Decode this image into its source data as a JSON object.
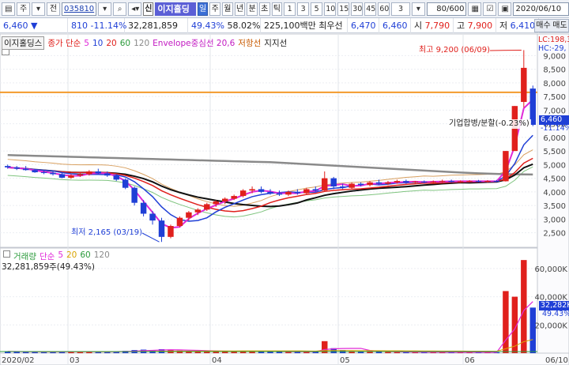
{
  "toolbar": {
    "menu_label": "주",
    "previous_label": "전",
    "code_value": "035810",
    "stock_name": "이지홀딩스",
    "credit_tag": "신",
    "periods": [
      "일",
      "주",
      "월",
      "년",
      "분",
      "초",
      "틱"
    ],
    "active_period": "일",
    "intervals": [
      "1",
      "3",
      "5",
      "10",
      "15",
      "30",
      "45",
      "60"
    ],
    "interval_select": "3",
    "count_value": "80",
    "count_total": "/600",
    "date_value": "2020/06/10"
  },
  "quote": {
    "price": "6,460",
    "change_arrow": "▼",
    "change": "810",
    "change_pct": "-11.14%",
    "volume": "32,281,859",
    "volume_ratio": "49.43%",
    "turnover_ratio": "58.02%",
    "amount": "225,100백만",
    "best_ask_label": "최우선",
    "best_ask": "6,470",
    "best_bid": "6,460",
    "open_label": "시",
    "open": "7,790",
    "high_label": "고",
    "high": "7,900",
    "low_label": "저",
    "low": "6,410",
    "sell_label": "매수",
    "buy_label": "매도"
  },
  "price_legend": {
    "name": "이지홀딩스",
    "ma_label": "종가 단순",
    "ma_periods": [
      "5",
      "10",
      "20",
      "60",
      "120"
    ],
    "envelope": "Envelope중심선 20,6",
    "resistance": "저항선",
    "support": "지지선"
  },
  "volume_legend": {
    "title": "거래량",
    "ma_label": "단순",
    "ma_periods": [
      "5",
      "20",
      "60",
      "120"
    ],
    "info": "32,281,859주(49.43%)"
  },
  "annotations": {
    "high_note": "최고 9,200 (06/09)",
    "low_note": "최저 2,165 (03/19)",
    "event_note": "기업합병/분할(-0.23%)",
    "upper_limit": "LC:198,3",
    "hc_label": "HC:-29,"
  },
  "price_axis": {
    "ticks": [
      "9,000",
      "8,500",
      "8,000",
      "7,500",
      "7,000",
      "6,500",
      "6,000",
      "5,500",
      "5,000",
      "4,500",
      "4,000",
      "3,500",
      "3,000",
      "2,500"
    ],
    "current_price_tag": "6,460",
    "current_change_tag": "-11.14%"
  },
  "volume_axis": {
    "ticks": [
      "60,000K",
      "40,000K",
      "20,000K"
    ],
    "current_volume_tag": "32,282K",
    "current_ratio_tag": "49.43%"
  },
  "date_axis": [
    "2020/02",
    "03",
    "04",
    "05",
    "06",
    "06/10"
  ],
  "colors": {
    "up": "#e0201c",
    "down": "#1f3fd6",
    "resistance_line": "#f39a2b",
    "ma5": "#e02ad8",
    "ma10": "#1f3fd6",
    "ma20": "#e0201c",
    "ma60": "#111111",
    "ma120": "#8a8a8a"
  },
  "chart_data": {
    "type": "candlestick",
    "price_ylim": [
      2200,
      9300
    ],
    "resistance_level": 7650,
    "candles": [
      {
        "o": 4950,
        "h": 5000,
        "l": 4850,
        "c": 4900
      },
      {
        "o": 4900,
        "h": 4950,
        "l": 4800,
        "c": 4850
      },
      {
        "o": 4850,
        "h": 4950,
        "l": 4780,
        "c": 4800
      },
      {
        "o": 4800,
        "h": 4850,
        "l": 4700,
        "c": 4720
      },
      {
        "o": 4720,
        "h": 4800,
        "l": 4650,
        "c": 4700
      },
      {
        "o": 4700,
        "h": 4780,
        "l": 4600,
        "c": 4650
      },
      {
        "o": 4650,
        "h": 4700,
        "l": 4500,
        "c": 4520
      },
      {
        "o": 4520,
        "h": 4650,
        "l": 4480,
        "c": 4600
      },
      {
        "o": 4600,
        "h": 4700,
        "l": 4550,
        "c": 4650
      },
      {
        "o": 4650,
        "h": 4800,
        "l": 4600,
        "c": 4750
      },
      {
        "o": 4750,
        "h": 4850,
        "l": 4650,
        "c": 4680
      },
      {
        "o": 4680,
        "h": 4750,
        "l": 4550,
        "c": 4600
      },
      {
        "o": 4600,
        "h": 4650,
        "l": 4400,
        "c": 4450
      },
      {
        "o": 4450,
        "h": 4500,
        "l": 4100,
        "c": 4150
      },
      {
        "o": 4150,
        "h": 4200,
        "l": 3500,
        "c": 3600
      },
      {
        "o": 3600,
        "h": 3700,
        "l": 3100,
        "c": 3200
      },
      {
        "o": 3200,
        "h": 3300,
        "l": 2800,
        "c": 2950
      },
      {
        "o": 2950,
        "h": 3050,
        "l": 2165,
        "c": 2350
      },
      {
        "o": 2350,
        "h": 2800,
        "l": 2300,
        "c": 2750
      },
      {
        "o": 2750,
        "h": 3100,
        "l": 2700,
        "c": 3050
      },
      {
        "o": 3050,
        "h": 3300,
        "l": 2950,
        "c": 3250
      },
      {
        "o": 3250,
        "h": 3400,
        "l": 3150,
        "c": 3350
      },
      {
        "o": 3350,
        "h": 3600,
        "l": 3300,
        "c": 3550
      },
      {
        "o": 3550,
        "h": 3700,
        "l": 3450,
        "c": 3650
      },
      {
        "o": 3650,
        "h": 3800,
        "l": 3550,
        "c": 3750
      },
      {
        "o": 3750,
        "h": 3900,
        "l": 3700,
        "c": 3850
      },
      {
        "o": 3850,
        "h": 4100,
        "l": 3800,
        "c": 4050
      },
      {
        "o": 4050,
        "h": 4200,
        "l": 3950,
        "c": 4100
      },
      {
        "o": 4100,
        "h": 4200,
        "l": 3950,
        "c": 4000
      },
      {
        "o": 4000,
        "h": 4100,
        "l": 3900,
        "c": 3950
      },
      {
        "o": 3950,
        "h": 4050,
        "l": 3850,
        "c": 3900
      },
      {
        "o": 3900,
        "h": 4050,
        "l": 3850,
        "c": 4000
      },
      {
        "o": 4000,
        "h": 4100,
        "l": 3900,
        "c": 3950
      },
      {
        "o": 3950,
        "h": 4150,
        "l": 3900,
        "c": 4100
      },
      {
        "o": 4100,
        "h": 4200,
        "l": 4000,
        "c": 4050
      },
      {
        "o": 4050,
        "h": 4750,
        "l": 4000,
        "c": 4500
      },
      {
        "o": 4500,
        "h": 4550,
        "l": 4100,
        "c": 4200
      },
      {
        "o": 4200,
        "h": 4300,
        "l": 4100,
        "c": 4150
      },
      {
        "o": 4150,
        "h": 4350,
        "l": 4100,
        "c": 4300
      },
      {
        "o": 4300,
        "h": 4350,
        "l": 4200,
        "c": 4250
      },
      {
        "o": 4250,
        "h": 4400,
        "l": 4200,
        "c": 4350
      },
      {
        "o": 4350,
        "h": 4450,
        "l": 4250,
        "c": 4300
      },
      {
        "o": 4300,
        "h": 4400,
        "l": 4250,
        "c": 4350
      },
      {
        "o": 4350,
        "h": 4450,
        "l": 4300,
        "c": 4400
      },
      {
        "o": 4400,
        "h": 4450,
        "l": 4300,
        "c": 4350
      },
      {
        "o": 4350,
        "h": 4400,
        "l": 4300,
        "c": 4380
      },
      {
        "o": 4380,
        "h": 4420,
        "l": 4320,
        "c": 4360
      },
      {
        "o": 4360,
        "h": 4420,
        "l": 4300,
        "c": 4380
      },
      {
        "o": 4380,
        "h": 4450,
        "l": 4330,
        "c": 4400
      },
      {
        "o": 4400,
        "h": 4450,
        "l": 4350,
        "c": 4380
      },
      {
        "o": 4380,
        "h": 4420,
        "l": 4330,
        "c": 4390
      },
      {
        "o": 4390,
        "h": 4430,
        "l": 4350,
        "c": 4400
      },
      {
        "o": 4400,
        "h": 4440,
        "l": 4350,
        "c": 4380
      },
      {
        "o": 4380,
        "h": 4430,
        "l": 4340,
        "c": 4400
      },
      {
        "o": 4400,
        "h": 4440,
        "l": 4360,
        "c": 4390
      },
      {
        "o": 4390,
        "h": 5500,
        "l": 4380,
        "c": 5500
      },
      {
        "o": 5500,
        "h": 7150,
        "l": 5500,
        "c": 7150
      },
      {
        "o": 7300,
        "h": 9200,
        "l": 7100,
        "c": 8550
      },
      {
        "o": 7790,
        "h": 7900,
        "l": 6410,
        "c": 6460
      }
    ],
    "volumes": [
      1.2,
      1.0,
      0.9,
      1.1,
      0.8,
      0.9,
      1.3,
      1.0,
      0.9,
      1.2,
      0.8,
      1.0,
      1.4,
      1.6,
      2.2,
      2.5,
      2.0,
      2.8,
      2.4,
      1.8,
      1.6,
      1.4,
      1.5,
      1.3,
      1.2,
      1.4,
      1.6,
      1.3,
      1.1,
      1.0,
      0.9,
      1.0,
      1.1,
      1.2,
      1.0,
      8.5,
      3.5,
      2.2,
      1.5,
      1.2,
      1.0,
      0.9,
      0.8,
      0.8,
      0.7,
      0.7,
      0.6,
      0.6,
      0.7,
      0.6,
      0.6,
      0.5,
      0.6,
      0.5,
      0.6,
      44.0,
      40.0,
      66.0,
      32.3
    ],
    "volume_ylim": [
      0,
      70
    ]
  }
}
